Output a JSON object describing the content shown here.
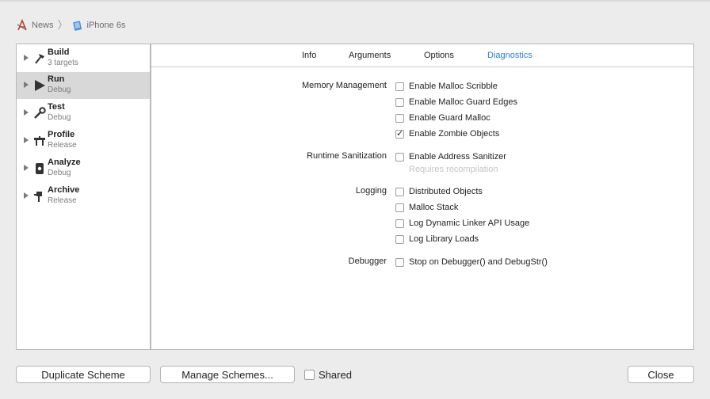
{
  "breadcrumb": {
    "project": "News",
    "device": "iPhone 6s"
  },
  "sidebar": {
    "items": [
      {
        "name": "Build",
        "sub": "3 targets",
        "icon": "hammer-icon"
      },
      {
        "name": "Run",
        "sub": "Debug",
        "icon": "play-icon"
      },
      {
        "name": "Test",
        "sub": "Debug",
        "icon": "wrench-icon"
      },
      {
        "name": "Profile",
        "sub": "Release",
        "icon": "instruments-icon"
      },
      {
        "name": "Analyze",
        "sub": "Debug",
        "icon": "analyze-icon"
      },
      {
        "name": "Archive",
        "sub": "Release",
        "icon": "archive-icon"
      }
    ],
    "selected": "Run"
  },
  "tabs": {
    "info": "Info",
    "arguments": "Arguments",
    "options": "Options",
    "diagnostics": "Diagnostics",
    "active": "Diagnostics"
  },
  "diagnostics": {
    "memory": {
      "label": "Memory Management",
      "options": [
        {
          "label": "Enable Malloc Scribble",
          "checked": false
        },
        {
          "label": "Enable Malloc Guard Edges",
          "checked": false
        },
        {
          "label": "Enable Guard Malloc",
          "checked": false
        },
        {
          "label": "Enable Zombie Objects",
          "checked": true
        }
      ]
    },
    "runtime": {
      "label": "Runtime Sanitization",
      "options": [
        {
          "label": "Enable Address Sanitizer",
          "checked": false
        }
      ],
      "hint": "Requires recompilation"
    },
    "logging": {
      "label": "Logging",
      "options": [
        {
          "label": "Distributed Objects",
          "checked": false
        },
        {
          "label": "Malloc Stack",
          "checked": false
        },
        {
          "label": "Log Dynamic Linker API Usage",
          "checked": false
        },
        {
          "label": "Log Library Loads",
          "checked": false
        }
      ]
    },
    "debugger": {
      "label": "Debugger",
      "options": [
        {
          "label": "Stop on Debugger() and DebugStr()",
          "checked": false
        }
      ]
    }
  },
  "footer": {
    "duplicate": "Duplicate Scheme",
    "manage": "Manage Schemes...",
    "shared": "Shared",
    "shared_checked": false,
    "close": "Close"
  },
  "colors": {
    "accent": "#2a7fd4",
    "selected_row": "#d8d8d8"
  },
  "check_glyph": "✓"
}
